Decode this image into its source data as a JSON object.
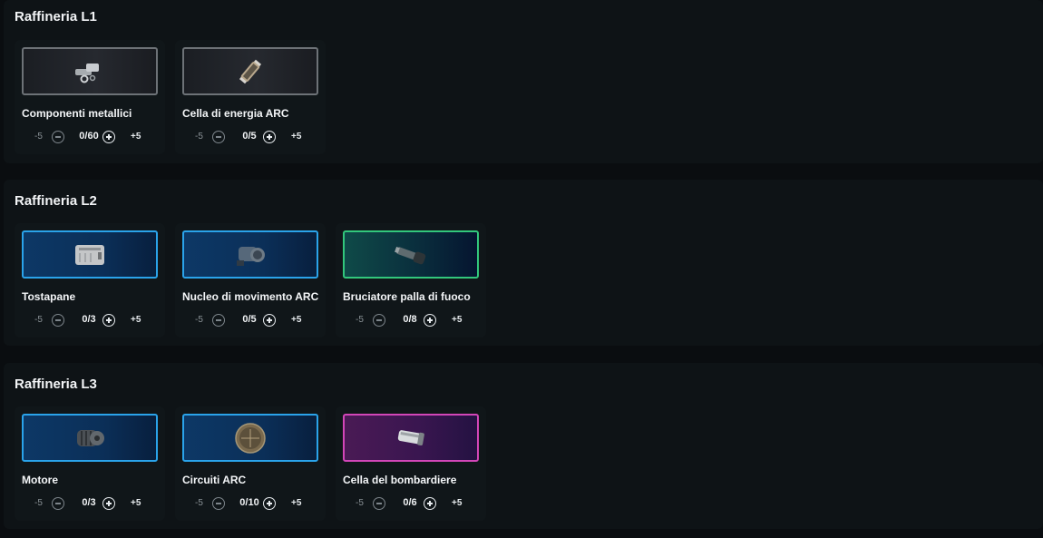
{
  "sections": [
    {
      "title": "Raffineria L1",
      "items": [
        {
          "name": "Componenti metallici",
          "qty": "0/60",
          "rarity": "common",
          "icon": "metal-parts-icon"
        },
        {
          "name": "Cella di energia ARC",
          "qty": "0/5",
          "rarity": "common",
          "icon": "energy-cell-icon"
        }
      ]
    },
    {
      "title": "Raffineria L2",
      "items": [
        {
          "name": "Tostapane",
          "qty": "0/3",
          "rarity": "uncommon",
          "icon": "toaster-icon"
        },
        {
          "name": "Nucleo di movimento ARC",
          "qty": "0/5",
          "rarity": "uncommon",
          "icon": "motion-core-icon"
        },
        {
          "name": "Bruciatore palla di fuoco",
          "qty": "0/8",
          "rarity": "rare",
          "icon": "fireball-burner-icon"
        }
      ]
    },
    {
      "title": "Raffineria L3",
      "items": [
        {
          "name": "Motore",
          "qty": "0/3",
          "rarity": "uncommon",
          "icon": "motor-icon"
        },
        {
          "name": "Circuiti ARC",
          "qty": "0/10",
          "rarity": "uncommon",
          "icon": "circuit-icon"
        },
        {
          "name": "Cella del bombardiere",
          "qty": "0/6",
          "rarity": "epic",
          "icon": "bombardier-cell-icon"
        }
      ]
    }
  ],
  "stepper": {
    "minus_label": "-5",
    "plus_label": "+5"
  },
  "colors": {
    "common": "#6d7277",
    "uncommon": "#2aa3ea",
    "rare": "#32c77c",
    "epic": "#d246b8"
  }
}
